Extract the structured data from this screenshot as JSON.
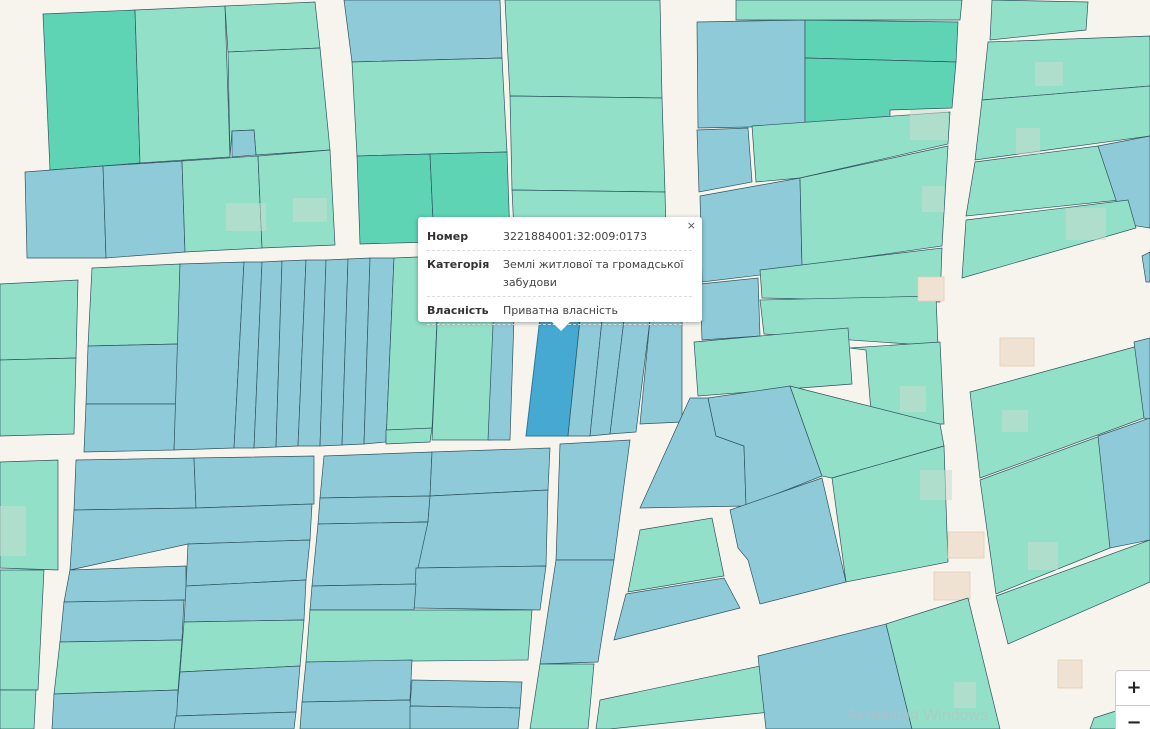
{
  "popup": {
    "close_label": "×",
    "rows": [
      {
        "key": "Номер",
        "value": "3221884001:32:009:0173"
      },
      {
        "key": "Категорія",
        "value": "Землі житлової та громадської забудови"
      },
      {
        "key": "Власність",
        "value": "Приватна власність"
      }
    ]
  },
  "zoom": {
    "in_label": "+",
    "out_label": "−"
  },
  "watermark": {
    "text": "Активація Windows"
  },
  "colors": {
    "residential_blue": "#8ecad8",
    "green_parcel": "#92e0c8",
    "dark_green_parcel": "#5ed4b4",
    "selected_parcel": "#45a9d1",
    "road": "#f7f4ee"
  }
}
